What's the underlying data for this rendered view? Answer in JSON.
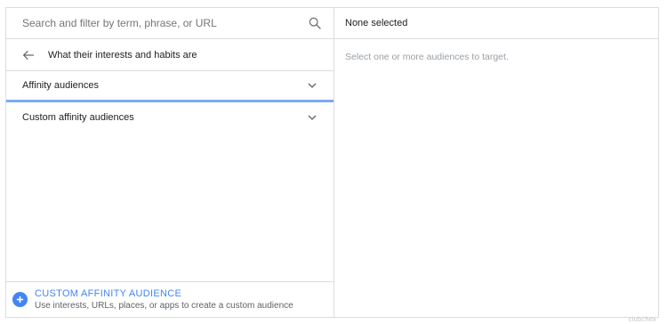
{
  "search": {
    "placeholder": "Search and filter by term, phrase, or URL",
    "icon": "search-icon"
  },
  "breadcrumb": {
    "label": "What their interests and habits are",
    "icon": "arrow-back-icon"
  },
  "categories": [
    {
      "label": "Affinity audiences",
      "icon": "chevron-down-icon",
      "active": true
    },
    {
      "label": "Custom affinity audiences",
      "icon": "chevron-down-icon",
      "active": false
    }
  ],
  "create": {
    "title": "CUSTOM AFFINITY AUDIENCE",
    "subtitle": "Use interests, URLs, places, or apps to create a custom audience",
    "icon": "plus-circle-icon"
  },
  "selection": {
    "header": "None selected",
    "empty_message": "Select one or more audiences to target."
  },
  "watermark": "clubchex",
  "colors": {
    "accent": "#4285f4",
    "active_underline": "#7baaf7",
    "border": "#dadce0",
    "muted_text": "#9aa0a6"
  }
}
